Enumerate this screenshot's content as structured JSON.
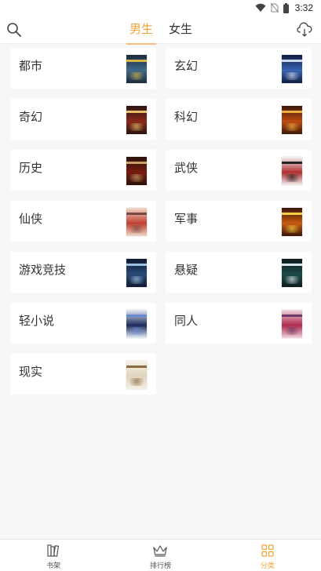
{
  "status_bar": {
    "time": "3:32"
  },
  "header": {
    "tabs": [
      {
        "label": "男生",
        "active": true
      },
      {
        "label": "女生",
        "active": false
      }
    ]
  },
  "categories": [
    {
      "label": "都市",
      "cover_colors": [
        "#1b2a3a",
        "#3f6a8a",
        "#d9b34a"
      ]
    },
    {
      "label": "玄幻",
      "cover_colors": [
        "#0f1d3d",
        "#3a63b5",
        "#cfd9ef"
      ]
    },
    {
      "label": "奇幻",
      "cover_colors": [
        "#2a1410",
        "#8a2a1a",
        "#e8c06a"
      ]
    },
    {
      "label": "科幻",
      "cover_colors": [
        "#3a1a08",
        "#c04a12",
        "#f0b040"
      ]
    },
    {
      "label": "历史",
      "cover_colors": [
        "#2a1208",
        "#7a1a10",
        "#c9a066"
      ]
    },
    {
      "label": "武侠",
      "cover_colors": [
        "#f2f2f2",
        "#b03030",
        "#222222"
      ]
    },
    {
      "label": "仙侠",
      "cover_colors": [
        "#f0d9c8",
        "#c04030",
        "#7a4a40"
      ]
    },
    {
      "label": "军事",
      "cover_colors": [
        "#3a1608",
        "#c85a10",
        "#f2d040"
      ]
    },
    {
      "label": "游戏竞技",
      "cover_colors": [
        "#0e1a2e",
        "#2a4a7a",
        "#9cc0e0"
      ]
    },
    {
      "label": "悬疑",
      "cover_colors": [
        "#0c1a1a",
        "#1e4a4a",
        "#d8e8e8"
      ]
    },
    {
      "label": "轻小说",
      "cover_colors": [
        "#e8eef8",
        "#1a2a5a",
        "#6a8ad8"
      ]
    },
    {
      "label": "同人",
      "cover_colors": [
        "#f0d8e0",
        "#b02a4a",
        "#6a3a6a"
      ]
    },
    {
      "label": "现实",
      "cover_colors": [
        "#f5f0e6",
        "#e0d4bc",
        "#8a6a40"
      ]
    }
  ],
  "bottom_nav": [
    {
      "label": "书架",
      "icon": "bookshelf-icon",
      "active": false
    },
    {
      "label": "排行榜",
      "icon": "crown-icon",
      "active": false
    },
    {
      "label": "分类",
      "icon": "grid-icon",
      "active": true
    }
  ],
  "colors": {
    "accent": "#f2a23a",
    "background": "#f7f7f7",
    "card": "#ffffff"
  }
}
